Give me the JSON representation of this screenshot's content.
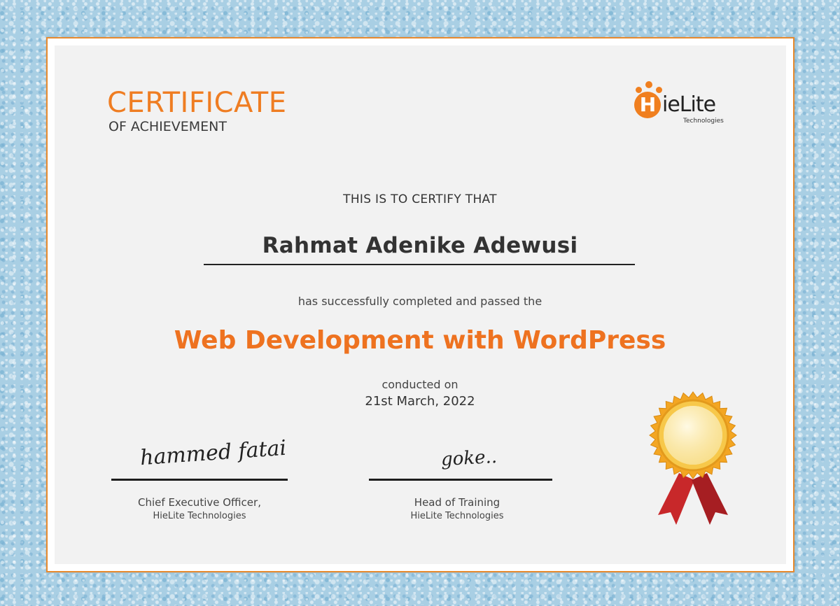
{
  "certificate": {
    "title": "CERTIFICATE",
    "subtitle": "OF ACHIEVEMENT",
    "certify_text": "THIS IS TO CERTIFY THAT",
    "recipient": "Rahmat Adenike Adewusi",
    "completed_text": "has successfully completed and passed the",
    "course": "Web Development with WordPress",
    "conducted_label": "conducted on",
    "date": "21st March, 2022"
  },
  "logo": {
    "initial": "H",
    "name_rest": "ieLite",
    "tagline": "Technologies"
  },
  "signatures": [
    {
      "script": "hammed fatai",
      "title": "Chief Executive Officer,",
      "organization": "HieLite Technologies"
    },
    {
      "script": "goke..",
      "title": "Head of Training",
      "organization": "HieLite Technologies"
    }
  ],
  "colors": {
    "accent": "#ee7220",
    "border": "#e78a2e",
    "paper": "#f2f2f2",
    "background": "#a9cfe4",
    "text": "#333333",
    "seal_gold": "#f3b52a",
    "ribbon_red": "#c8282a"
  }
}
